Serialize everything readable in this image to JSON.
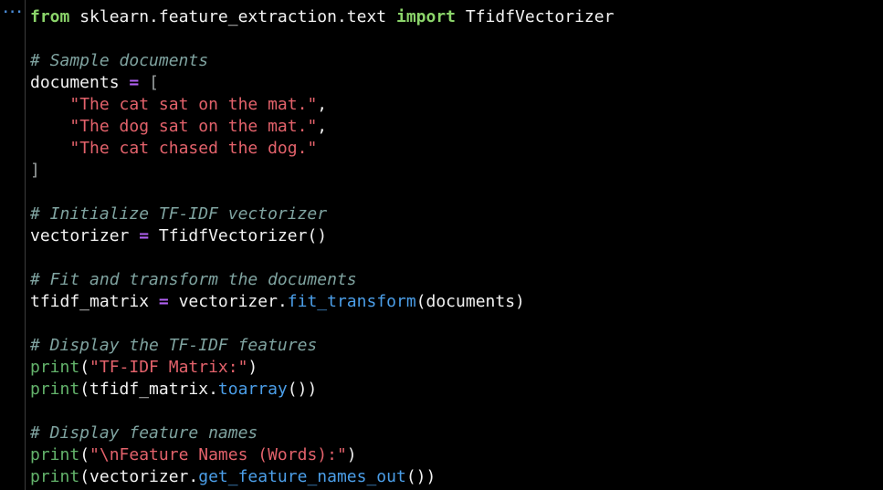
{
  "gutter": {
    "indicator": "..."
  },
  "editor": {
    "lines": [
      [
        {
          "t": "kw",
          "v": "from"
        },
        {
          "t": "plain",
          "v": " sklearn.feature_extraction.text "
        },
        {
          "t": "kw",
          "v": "import"
        },
        {
          "t": "plain",
          "v": " TfidfVectorizer"
        }
      ],
      [],
      [
        {
          "t": "comment",
          "v": "# Sample documents"
        }
      ],
      [
        {
          "t": "plain",
          "v": "documents "
        },
        {
          "t": "op",
          "v": "="
        },
        {
          "t": "plain",
          "v": " "
        },
        {
          "t": "bracket",
          "v": "["
        }
      ],
      [
        {
          "t": "plain",
          "v": "    "
        },
        {
          "t": "string",
          "v": "\"The cat sat on the mat.\""
        },
        {
          "t": "plain",
          "v": ","
        }
      ],
      [
        {
          "t": "plain",
          "v": "    "
        },
        {
          "t": "string",
          "v": "\"The dog sat on the mat.\""
        },
        {
          "t": "plain",
          "v": ","
        }
      ],
      [
        {
          "t": "plain",
          "v": "    "
        },
        {
          "t": "string",
          "v": "\"The cat chased the dog.\""
        }
      ],
      [
        {
          "t": "bracket",
          "v": "]"
        }
      ],
      [],
      [
        {
          "t": "comment",
          "v": "# Initialize TF-IDF vectorizer"
        }
      ],
      [
        {
          "t": "plain",
          "v": "vectorizer "
        },
        {
          "t": "op",
          "v": "="
        },
        {
          "t": "plain",
          "v": " TfidfVectorizer()"
        }
      ],
      [],
      [
        {
          "t": "comment",
          "v": "# Fit and transform the documents"
        }
      ],
      [
        {
          "t": "plain",
          "v": "tfidf_matrix "
        },
        {
          "t": "op",
          "v": "="
        },
        {
          "t": "plain",
          "v": " vectorizer."
        },
        {
          "t": "func",
          "v": "fit_transform"
        },
        {
          "t": "plain",
          "v": "(documents)"
        }
      ],
      [],
      [
        {
          "t": "comment",
          "v": "# Display the TF-IDF features"
        }
      ],
      [
        {
          "t": "builtin",
          "v": "print"
        },
        {
          "t": "plain",
          "v": "("
        },
        {
          "t": "string",
          "v": "\"TF-IDF Matrix:\""
        },
        {
          "t": "plain",
          "v": ")"
        }
      ],
      [
        {
          "t": "builtin",
          "v": "print"
        },
        {
          "t": "plain",
          "v": "(tfidf_matrix."
        },
        {
          "t": "func",
          "v": "toarray"
        },
        {
          "t": "plain",
          "v": "())"
        }
      ],
      [],
      [
        {
          "t": "comment",
          "v": "# Display feature names"
        }
      ],
      [
        {
          "t": "builtin",
          "v": "print"
        },
        {
          "t": "plain",
          "v": "("
        },
        {
          "t": "string",
          "v": "\"\\nFeature Names (Words):\""
        },
        {
          "t": "plain",
          "v": ")"
        }
      ],
      [
        {
          "t": "builtin",
          "v": "print"
        },
        {
          "t": "plain",
          "v": "(vectorizer."
        },
        {
          "t": "func",
          "v": "get_feature_names_out"
        },
        {
          "t": "plain",
          "v": "())"
        }
      ]
    ]
  },
  "colors": {
    "background": "#000000",
    "plain": "#f2f2f2",
    "keyword": "#8bd46a",
    "comment": "#7fa3a0",
    "operator": "#b161f2",
    "string": "#e3626b",
    "builtin": "#63b36b",
    "function": "#4b9ee8",
    "gutter_indicator": "#4a8cd8"
  }
}
